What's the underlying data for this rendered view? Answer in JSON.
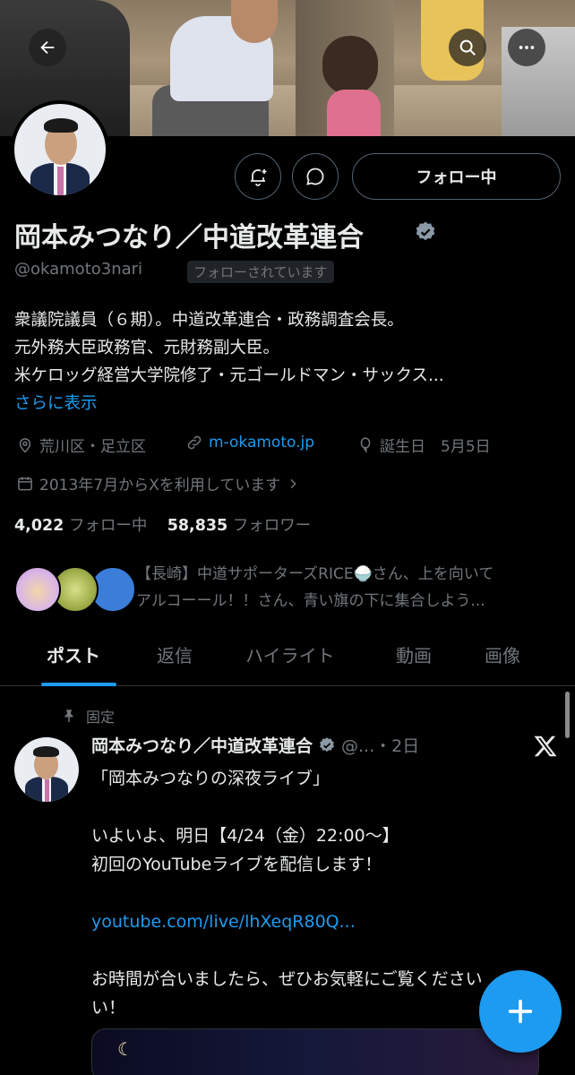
{
  "header": {
    "back_label": "←",
    "search_label": "search",
    "more_label": "more"
  },
  "profile": {
    "display_name": "岡本みつなり／中道改革連合",
    "handle": "@okamoto3nari",
    "follows_you": "フォローされています",
    "follow_button": "フォロー中",
    "bio": [
      "衆議院議員（６期）。中道改革連合・政務調査会長。",
      "元外務大臣政務官、元財務副大臣。",
      "米ケロッグ経営大学院修了・元ゴールドマン・サックス..."
    ],
    "show_more": "さらに表示",
    "location": "荒川区・足立区",
    "website": "m-okamoto.jp",
    "birthday": "誕生日　5月5日",
    "joined": "2013年7月からXを利用しています",
    "following_count": "4,022",
    "following_label": "フォロー中",
    "followers_count": "58,835",
    "followers_label": "フォロワー",
    "followers_you_know": [
      "【長崎】中道サポーターズRICE🍚さん、上を向いて",
      "アルコーール！！さん、青い旗の下に集合しよう..."
    ]
  },
  "tabs": [
    "ポスト",
    "返信",
    "ハイライト",
    "動画",
    "画像"
  ],
  "pinned_tweet": {
    "pinned_label": "固定",
    "author": "岡本みつなり／中道改革連合",
    "handle_time": "@...・2日",
    "lines": [
      "「岡本みつなりの深夜ライブ」",
      "",
      "いよいよ、明日【4/24（金）22:00〜】",
      "初回のYouTubeライブを配信します！",
      "",
      "youtube.com/live/lhXeqR80Q...",
      "",
      "お時間が合いましたら、ぜひお気軽にご覧ください",
      "い！"
    ]
  },
  "colors": {
    "accent": "#1d9bf0",
    "background": "#000000",
    "text": "#e7e9ea",
    "muted": "#71767b"
  }
}
